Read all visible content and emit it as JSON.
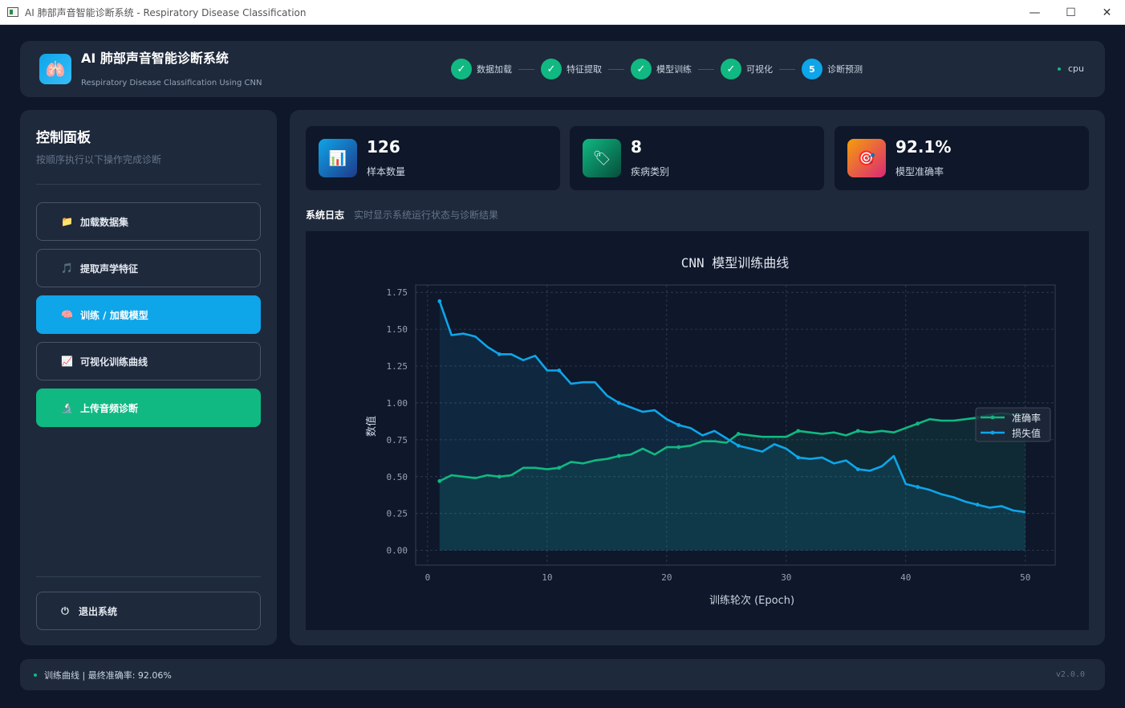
{
  "window": {
    "title": "AI 肺部声音智能诊断系统 - Respiratory Disease Classification",
    "min": "—",
    "max": "☐",
    "close": "✕"
  },
  "header": {
    "logo_icon": "lungs-icon",
    "title": "AI 肺部声音智能诊断系统",
    "subtitle": "Respiratory Disease Classification Using CNN",
    "steps": [
      {
        "num": "✓",
        "label": "数据加载",
        "state": "done"
      },
      {
        "num": "✓",
        "label": "特征提取",
        "state": "done"
      },
      {
        "num": "✓",
        "label": "模型训练",
        "state": "done"
      },
      {
        "num": "✓",
        "label": "可视化",
        "state": "done"
      },
      {
        "num": "5",
        "label": "诊断预测",
        "state": "current"
      }
    ],
    "device": "cpu"
  },
  "sidebar": {
    "title": "控制面板",
    "subtitle": "按顺序执行以下操作完成诊断",
    "buttons": [
      {
        "icon": "📁",
        "label": "加载数据集"
      },
      {
        "icon": "🎵",
        "label": "提取声学特征"
      },
      {
        "icon": "🧠",
        "label": "训练 / 加载模型"
      },
      {
        "icon": "📈",
        "label": "可视化训练曲线"
      },
      {
        "icon": "🔬",
        "label": "上传音频诊断"
      }
    ],
    "exit": {
      "icon": "⏻",
      "label": "退出系统"
    }
  },
  "stats": [
    {
      "icon": "📊",
      "value": "126",
      "label": "样本数量"
    },
    {
      "icon": "🏷",
      "value": "8",
      "label": "疾病类别"
    },
    {
      "icon": "🎯",
      "value": "92.1%",
      "label": "模型准确率"
    }
  ],
  "log": {
    "title": "系统日志",
    "subtitle": "实时显示系统运行状态与诊断结果"
  },
  "chart_data": {
    "type": "line",
    "title": "CNN 模型训练曲线",
    "xlabel": "训练轮次 (Epoch)",
    "ylabel": "数值",
    "xlim": [
      -1,
      52.5
    ],
    "ylim": [
      -0.1,
      1.8
    ],
    "xticks": [
      0,
      10,
      20,
      30,
      40,
      50
    ],
    "yticks": [
      "0.00",
      "0.25",
      "0.50",
      "0.75",
      "1.00",
      "1.25",
      "1.50",
      "1.75"
    ],
    "grid": true,
    "legend": "right",
    "x": [
      1,
      2,
      3,
      4,
      5,
      6,
      7,
      8,
      9,
      10,
      11,
      12,
      13,
      14,
      15,
      16,
      17,
      18,
      19,
      20,
      21,
      22,
      23,
      24,
      25,
      26,
      27,
      28,
      29,
      30,
      31,
      32,
      33,
      34,
      35,
      36,
      37,
      38,
      39,
      40,
      41,
      42,
      43,
      44,
      45,
      46,
      47,
      48,
      49,
      50
    ],
    "series": [
      {
        "name": "准确率",
        "color": "#10b981",
        "values": [
          0.47,
          0.51,
          0.5,
          0.49,
          0.51,
          0.5,
          0.51,
          0.56,
          0.56,
          0.55,
          0.56,
          0.6,
          0.59,
          0.61,
          0.62,
          0.64,
          0.65,
          0.69,
          0.65,
          0.7,
          0.7,
          0.71,
          0.74,
          0.74,
          0.73,
          0.79,
          0.78,
          0.77,
          0.77,
          0.77,
          0.81,
          0.8,
          0.79,
          0.8,
          0.78,
          0.81,
          0.8,
          0.81,
          0.8,
          0.83,
          0.86,
          0.89,
          0.88,
          0.88,
          0.89,
          0.9,
          0.92,
          0.93,
          0.92,
          0.92
        ]
      },
      {
        "name": "损失值",
        "color": "#0ea5e9",
        "values": [
          1.69,
          1.46,
          1.47,
          1.45,
          1.38,
          1.33,
          1.33,
          1.29,
          1.32,
          1.22,
          1.22,
          1.13,
          1.14,
          1.14,
          1.05,
          1.0,
          0.97,
          0.94,
          0.95,
          0.89,
          0.85,
          0.83,
          0.78,
          0.81,
          0.76,
          0.71,
          0.69,
          0.67,
          0.72,
          0.69,
          0.63,
          0.62,
          0.63,
          0.59,
          0.61,
          0.55,
          0.54,
          0.57,
          0.64,
          0.45,
          0.43,
          0.41,
          0.38,
          0.36,
          0.33,
          0.31,
          0.29,
          0.3,
          0.27,
          0.26
        ]
      }
    ]
  },
  "status": {
    "text": "训练曲线 | 最终准确率: 92.06%",
    "version": "v2.0.0"
  }
}
